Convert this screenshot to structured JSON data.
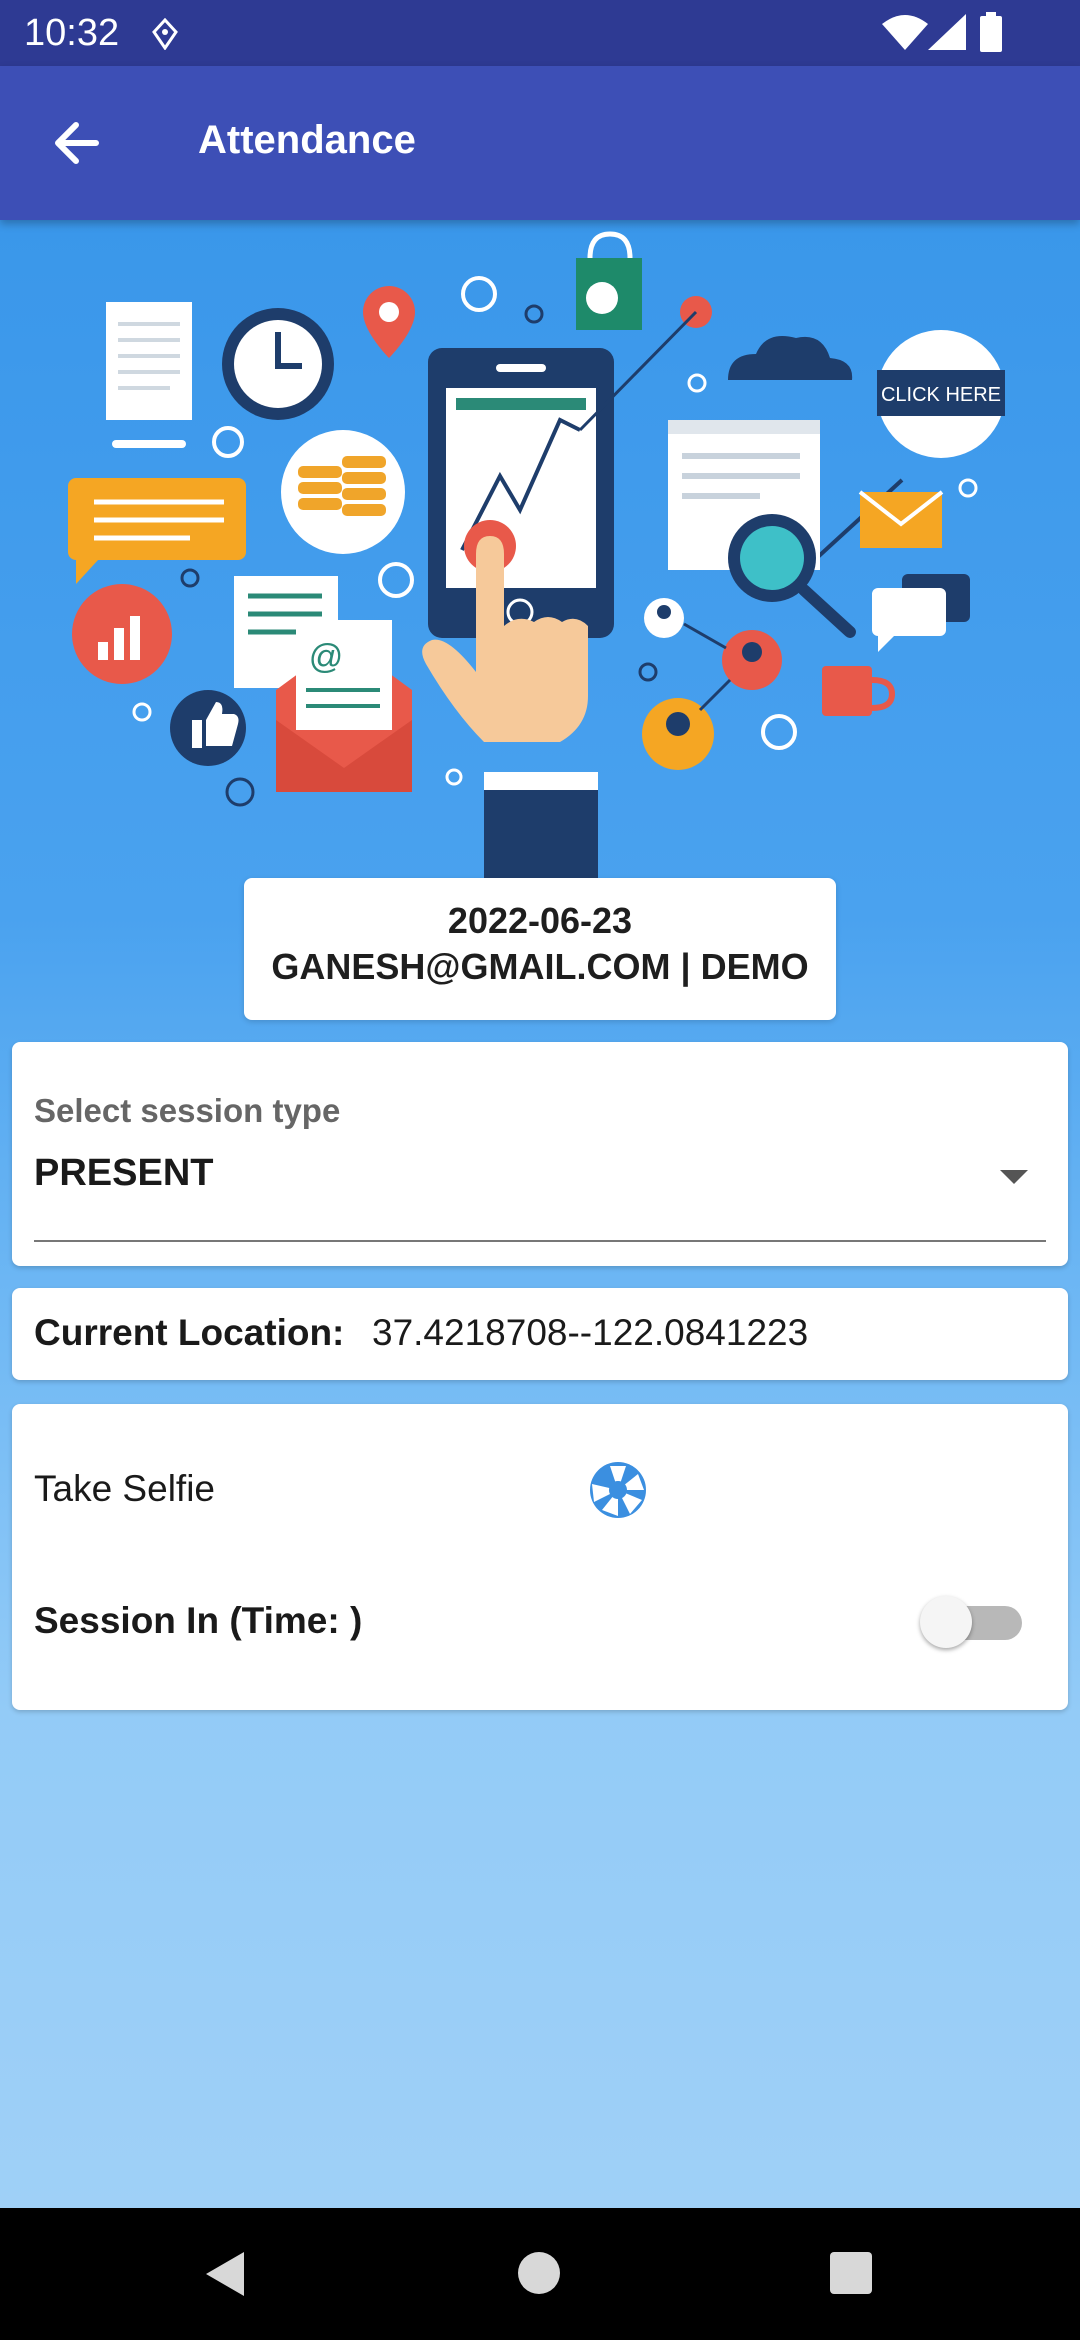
{
  "status_bar": {
    "time": "10:32",
    "icons": [
      "location-sync-icon",
      "wifi-icon",
      "signal-icon",
      "battery-icon"
    ]
  },
  "app_bar": {
    "title": "Attendance",
    "back_icon": "arrow-back-icon"
  },
  "hero": {
    "banner_text": "CLICK HERE"
  },
  "info": {
    "date": "2022-06-23",
    "user_line": "GANESH@GMAIL.COM | DEMO"
  },
  "session_type": {
    "label": "Select session type",
    "value": "PRESENT"
  },
  "location": {
    "label": "Current Location:",
    "value": "37.4218708--122.0841223"
  },
  "selfie": {
    "label": "Take Selfie",
    "icon": "camera-shutter-icon"
  },
  "session_in": {
    "label": "Session In (Time: )",
    "enabled": false
  },
  "colors": {
    "status_bar": "#2e3a93",
    "app_bar": "#3d4fb6",
    "background": "#4aa2ef",
    "accent": "#3b8fe0"
  }
}
